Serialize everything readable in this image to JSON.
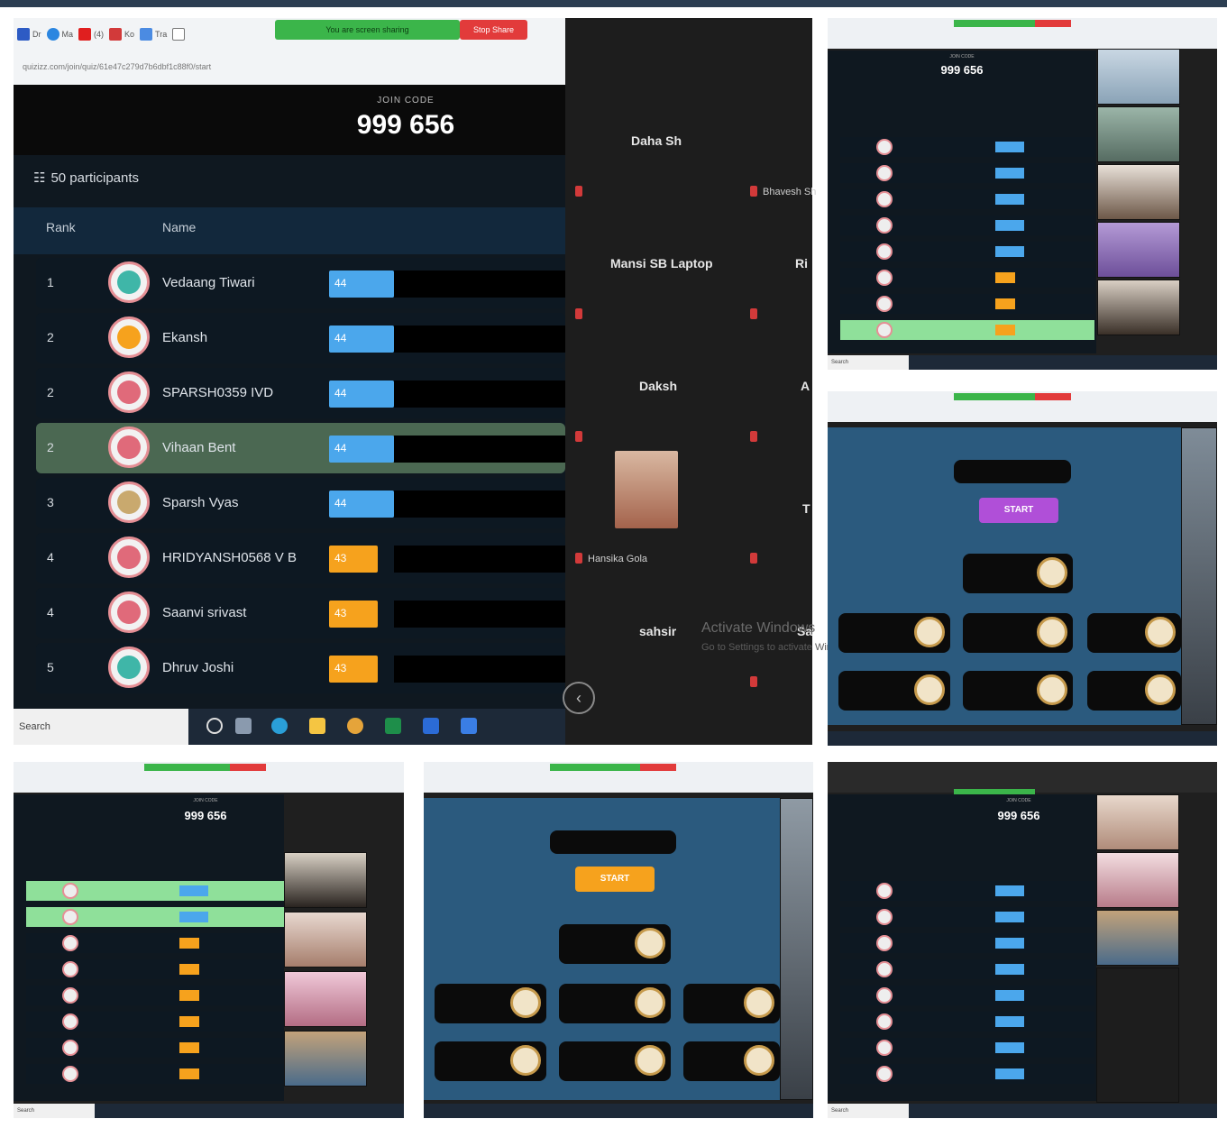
{
  "main": {
    "tabs": [
      {
        "label": "Dr",
        "icon": "facebook-icon",
        "color": "#2d5bc4"
      },
      {
        "label": "Ma",
        "icon": "blue-circle-icon",
        "color": "#2b86e0"
      },
      {
        "label": "(4)",
        "icon": "youtube-icon",
        "color": "#e01f1f"
      },
      {
        "label": "Ko",
        "icon": "red-app-icon",
        "color": "#d23a3a"
      },
      {
        "label": "Tra",
        "icon": "translate-icon",
        "color": "#4b8be2"
      },
      {
        "label": "",
        "icon": "doc-icon",
        "color": "#777777"
      }
    ],
    "share_banner": "You are screen sharing",
    "stop_share": "Stop Share",
    "url": "quizizz.com/join/quiz/61e47c279d7b6dbf1c88f0/start",
    "join_label": "JOIN CODE",
    "join_code": "999 656",
    "participants": "50 participants",
    "col_rank": "Rank",
    "col_name": "Name",
    "leaderboard": [
      {
        "rank": "1",
        "name": "Vedaang Tiwari",
        "score": "44",
        "color": "blue",
        "avatar": "#3fb6a8",
        "highlight": false
      },
      {
        "rank": "2",
        "name": "Ekansh",
        "score": "44",
        "color": "blue",
        "avatar": "#f6a21d",
        "highlight": false
      },
      {
        "rank": "2",
        "name": "SPARSH0359 IVD",
        "score": "44",
        "color": "blue",
        "avatar": "#e06a7a",
        "highlight": false
      },
      {
        "rank": "2",
        "name": "Vihaan Bent",
        "score": "44",
        "color": "blue",
        "avatar": "#e06a7a",
        "highlight": true
      },
      {
        "rank": "3",
        "name": "Sparsh Vyas",
        "score": "44",
        "color": "blue",
        "avatar": "#c9a96e",
        "highlight": false
      },
      {
        "rank": "4",
        "name": "HRIDYANSH0568 V B",
        "score": "43",
        "color": "orange",
        "avatar": "#e06a7a",
        "highlight": false
      },
      {
        "rank": "4",
        "name": "Saanvi srivast",
        "score": "43",
        "color": "orange",
        "avatar": "#e06a7a",
        "highlight": false
      },
      {
        "rank": "5",
        "name": "Dhruv Joshi",
        "score": "43",
        "color": "orange",
        "avatar": "#3fb6a8",
        "highlight": false
      }
    ],
    "search": "Search",
    "gallery": {
      "names": [
        "Daha Sh",
        "Mansi SB Laptop",
        "Daksh",
        "sahsir"
      ],
      "small": [
        "Bhavesh Sh",
        "Hansika Gola"
      ],
      "side": [
        "Ri",
        "A",
        "T",
        "Sa"
      ],
      "activate": "Activate Windows",
      "activate_hint": "Go to Settings to activate Windows."
    }
  },
  "mini": {
    "join_code": "999 656",
    "start": "START"
  }
}
